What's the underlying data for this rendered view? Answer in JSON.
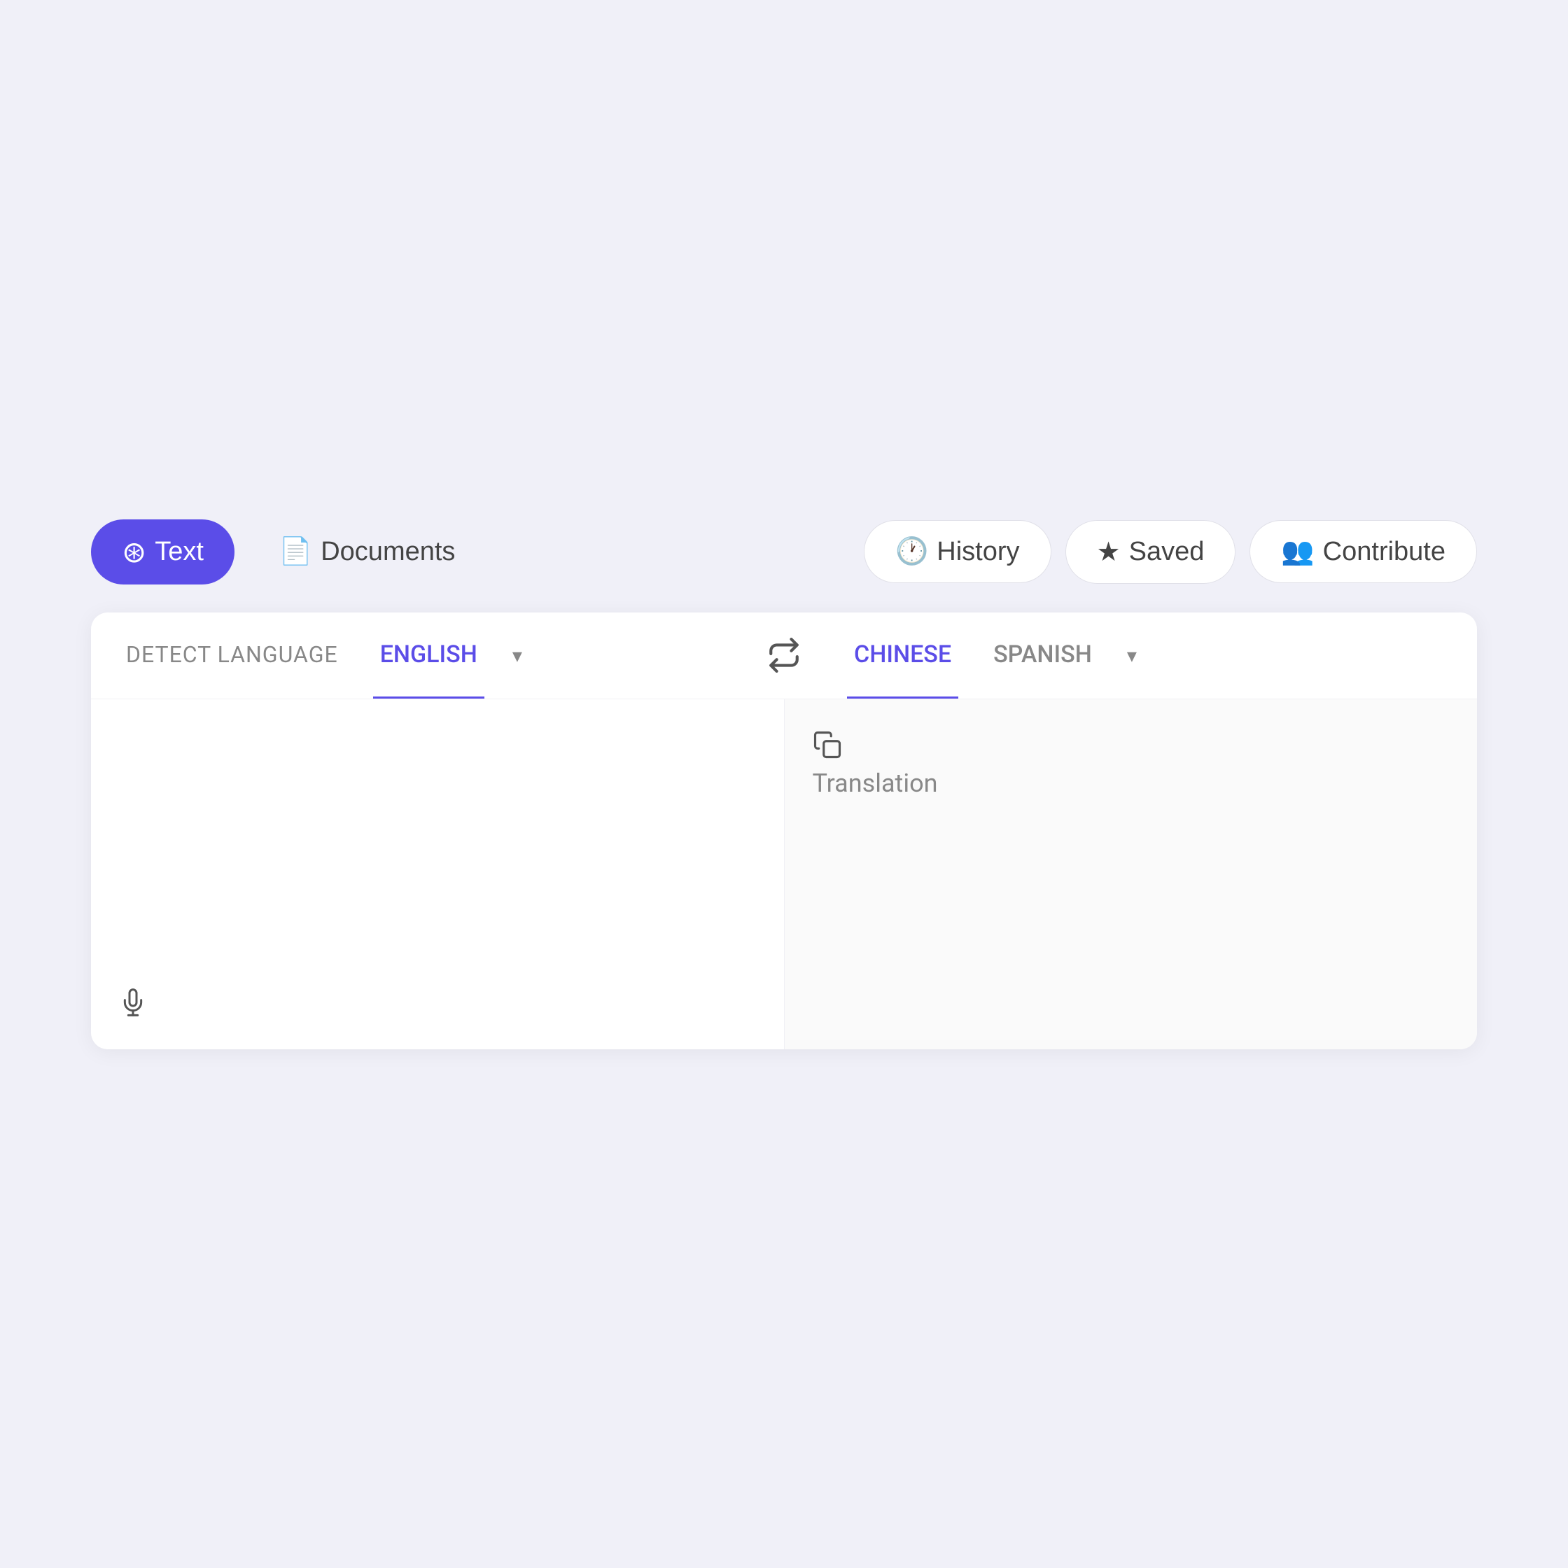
{
  "toolbar": {
    "text_label": "Text",
    "documents_label": "Documents",
    "history_label": "History",
    "saved_label": "Saved",
    "contribute_label": "Contribute"
  },
  "language_bar": {
    "detect_label": "DETECT LANGUAGE",
    "source_active": "ENGLISH",
    "swap_icon": "⇄",
    "target_active": "CHINESE",
    "target_other": "SPANISH",
    "dropdown_icon": "▾"
  },
  "translation": {
    "placeholder": "Translation"
  },
  "colors": {
    "accent": "#5b4de8",
    "bg": "#f0f0f8"
  }
}
